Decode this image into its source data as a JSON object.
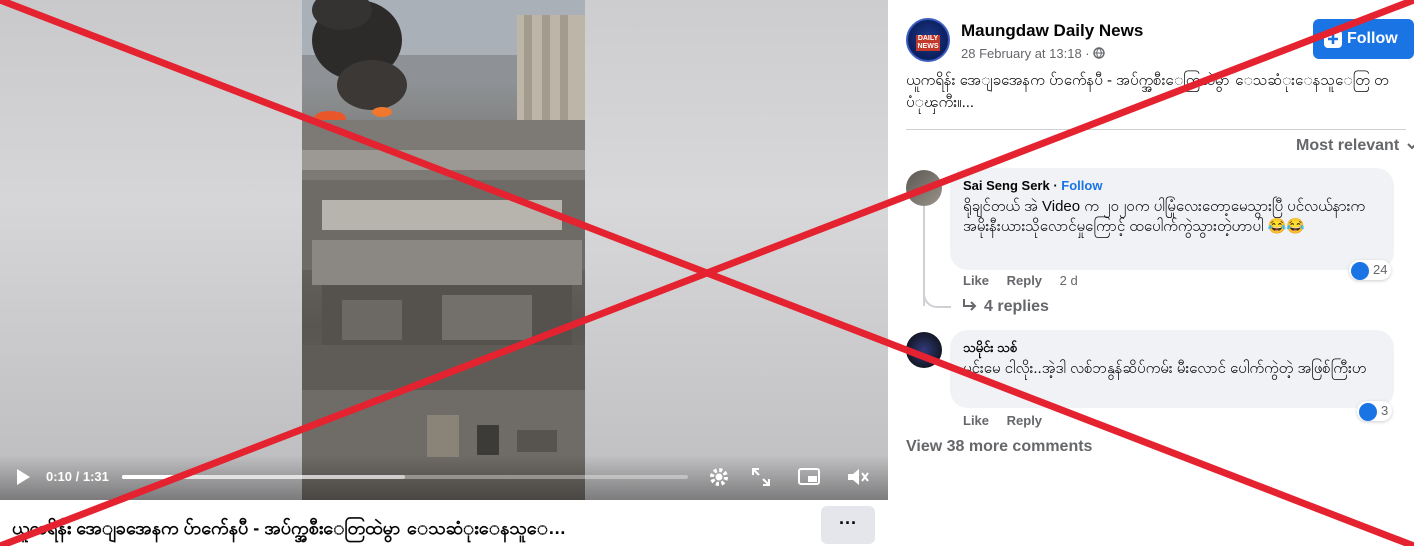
{
  "video": {
    "time_current": "0:10",
    "time_total": "1:31",
    "progress": 0.11,
    "buffered": 0.5
  },
  "caption": {
    "text": "ယူကရိန်း အေျခအေနက ပ်ာက်ေနပီ - အပ်က္အစီးေတြထဲမွာ ေသဆံုးေနသူေ…",
    "more_label": "···"
  },
  "post": {
    "page_name": "Maungdaw Daily News",
    "avatar_text": "DAILY NEWS",
    "date": "28 February at 13:18 ·",
    "follow_label": "Follow",
    "text": "ယူကရိန်း အေျခအေနက ပ်ာက်ေနပီ - အပ်က္အစီးေတြထဲမွာ ေသဆံုးေနသူေတြ တပံုၾကီး။..."
  },
  "comments_section": {
    "sort_label": "Most relevant",
    "view_more": "View 38 more comments",
    "comments": [
      {
        "author": "Sai Seng Serk",
        "follow": "Follow",
        "text": "ရိုချင်တယ် အဲ Video က ၂၀၂၀က ပါမြုံလေးတော့မေသွားပြီ ပင်လယ်နားက အမိုးနီးယားသိုလောင်မှုကြောင့် ထပေါက်ကွဲသွားတဲ့ဟာပါ 😂😂",
        "like": "Like",
        "reply": "Reply",
        "time": "2 d",
        "reactions": "24",
        "replies": "4 replies"
      },
      {
        "author": "သမိုင်း သစ်",
        "text": "မင်းမေ ငါလိုး..အဲ့ဒါ လစ်ဘနွန်ဆိပ်ကမ်း မီးလောင် ပေါက်ကွဲတဲ့ အဖြစ်ကြီးဟ",
        "like": "Like",
        "reply": "Reply",
        "reactions": "3"
      }
    ]
  },
  "colors": {
    "accent": "#1b74e4",
    "cross": "#e5222f"
  }
}
